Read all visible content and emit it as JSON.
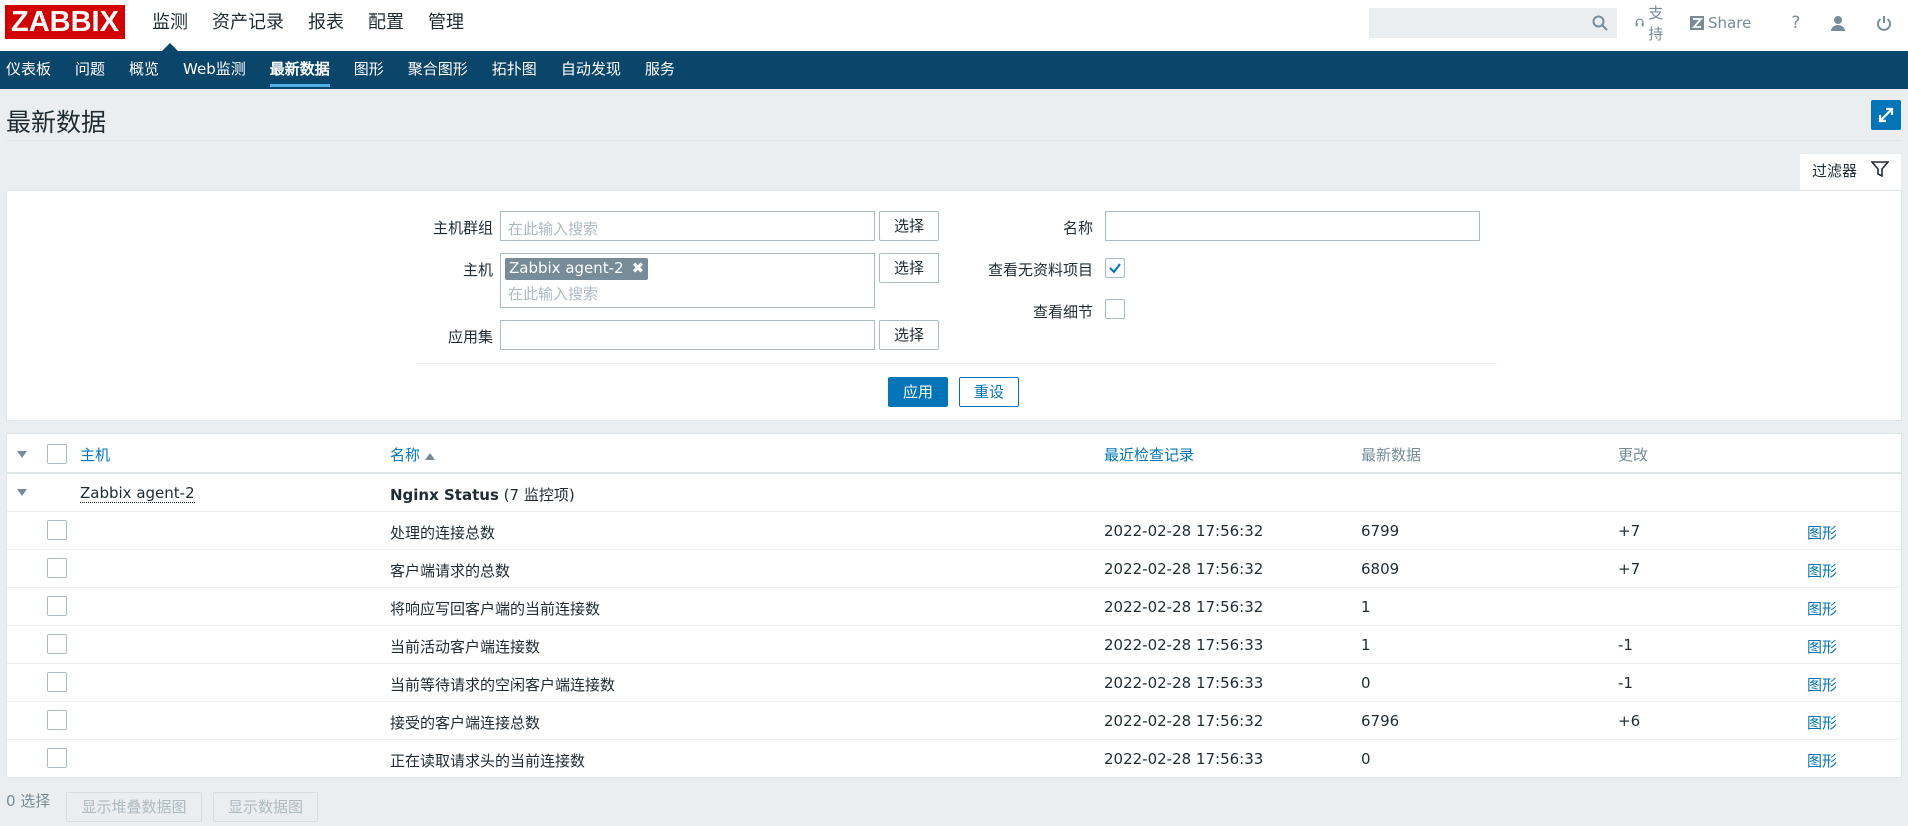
{
  "logo": "ZABBIX",
  "main_nav": [
    "监测",
    "资产记录",
    "报表",
    "配置",
    "管理"
  ],
  "search": {
    "placeholder": ""
  },
  "top_links": {
    "support": "支持",
    "share": "Share",
    "help": "?"
  },
  "sub_nav": [
    "仪表板",
    "问题",
    "概览",
    "Web监测",
    "最新数据",
    "图形",
    "聚合图形",
    "拓扑图",
    "自动发现",
    "服务"
  ],
  "page_title": "最新数据",
  "filter": {
    "tab_label": "过滤器",
    "host_group_label": "主机群组",
    "host_group_placeholder": "在此输入搜索",
    "select_label": "选择",
    "host_label": "主机",
    "host_tag": "Zabbix agent-2",
    "host_placeholder": "在此输入搜索",
    "application_label": "应用集",
    "application_value": "",
    "name_label": "名称",
    "name_value": "",
    "show_without_data_label": "查看无资料项目",
    "show_without_data_checked": true,
    "show_details_label": "查看细节",
    "show_details_checked": false,
    "apply_label": "应用",
    "reset_label": "重设"
  },
  "table": {
    "headers": {
      "host": "主机",
      "name": "名称",
      "last_check": "最近检查记录",
      "last_value": "最新数据",
      "change": "更改"
    },
    "group": {
      "host": "Zabbix agent-2",
      "app": "Nginx Status",
      "count": "(7 监控项)"
    },
    "graph_label": "图形",
    "rows": [
      {
        "name": "处理的连接总数",
        "last_check": "2022-02-28 17:56:32",
        "last_value": "6799",
        "change": "+7"
      },
      {
        "name": "客户端请求的总数",
        "last_check": "2022-02-28 17:56:32",
        "last_value": "6809",
        "change": "+7"
      },
      {
        "name": "将响应写回客户端的当前连接数",
        "last_check": "2022-02-28 17:56:32",
        "last_value": "1",
        "change": ""
      },
      {
        "name": "当前活动客户端连接数",
        "last_check": "2022-02-28 17:56:33",
        "last_value": "1",
        "change": "-1"
      },
      {
        "name": "当前等待请求的空闲客户端连接数",
        "last_check": "2022-02-28 17:56:33",
        "last_value": "0",
        "change": "-1"
      },
      {
        "name": "接受的客户端连接总数",
        "last_check": "2022-02-28 17:56:32",
        "last_value": "6796",
        "change": "+6"
      },
      {
        "name": "正在读取请求头的当前连接数",
        "last_check": "2022-02-28 17:56:33",
        "last_value": "0",
        "change": ""
      }
    ]
  },
  "footer": {
    "selected": "0 选择",
    "stacked_graph": "显示堆叠数据图",
    "data_graph": "显示数据图"
  },
  "colors": {
    "brand": "#d40000",
    "nav": "#0a466a",
    "accent": "#0275b8"
  }
}
